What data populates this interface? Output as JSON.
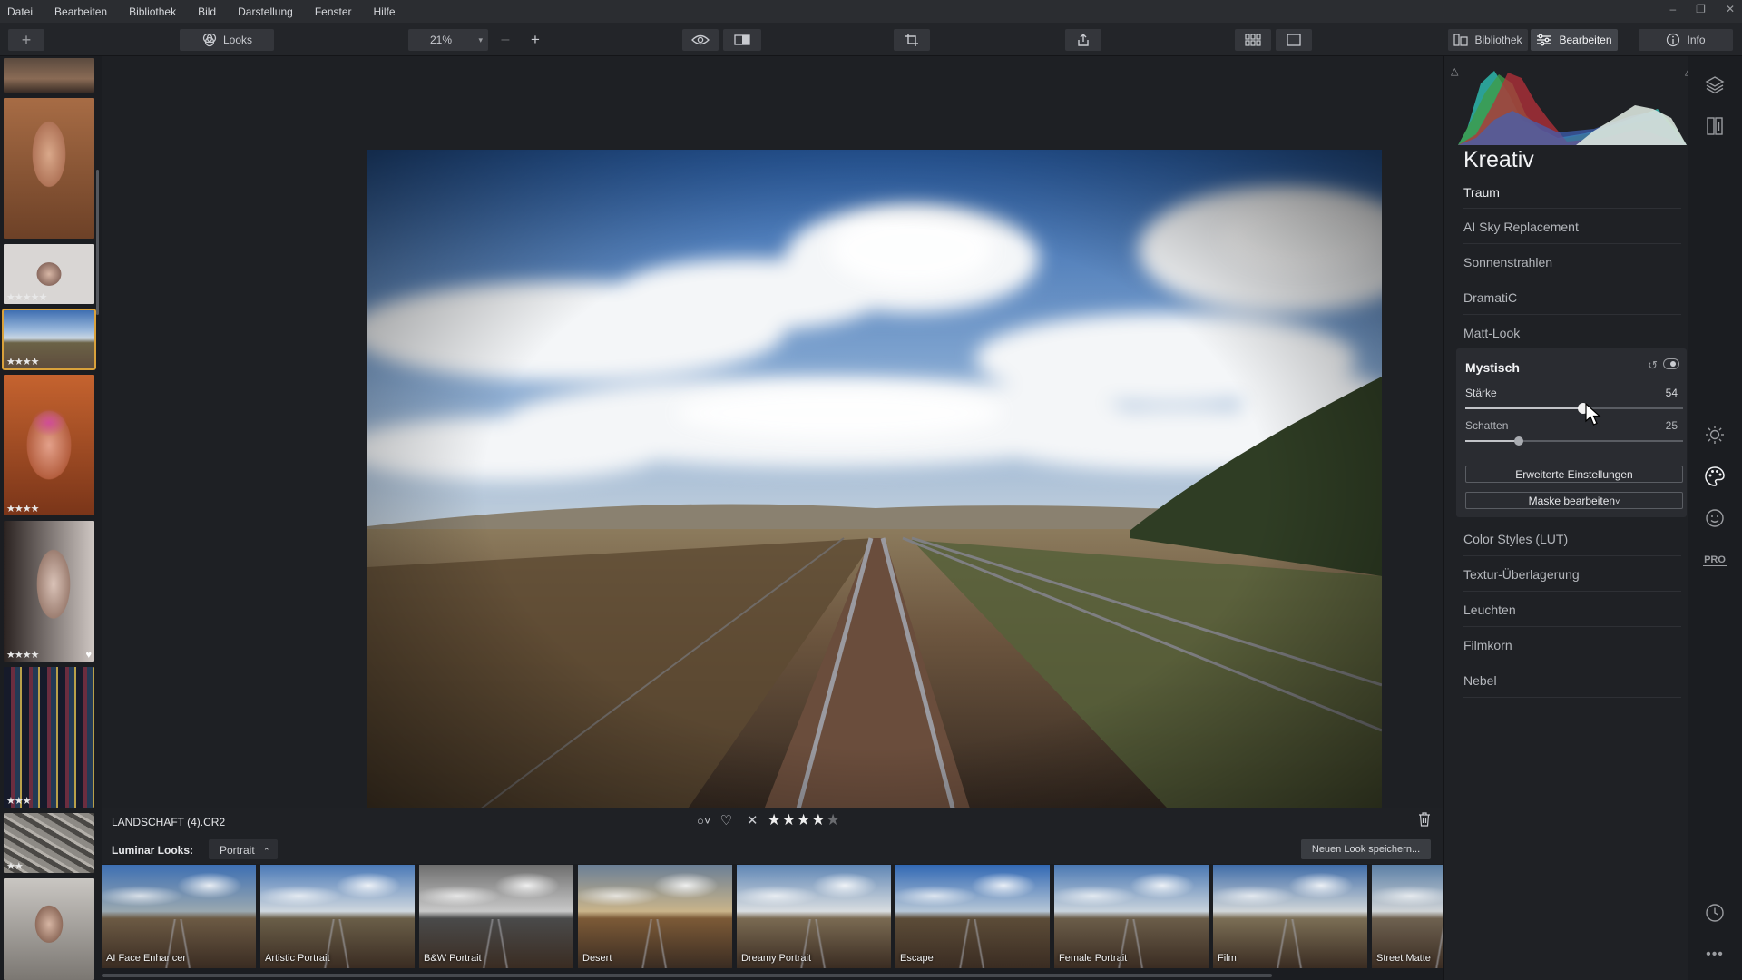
{
  "menu": [
    "Datei",
    "Bearbeiten",
    "Bibliothek",
    "Bild",
    "Darstellung",
    "Fenster",
    "Hilfe"
  ],
  "toolbar": {
    "looks_label": "Looks",
    "zoom": "21%",
    "view_tabs": [
      "Bibliothek",
      "Bearbeiten",
      "Info"
    ]
  },
  "filmstrip": [
    {
      "stars": ""
    },
    {
      "stars": ""
    },
    {
      "stars": "★★★★★"
    },
    {
      "stars": "★★★★"
    },
    {
      "stars": "★★★★"
    },
    {
      "stars": "★★★★"
    },
    {
      "stars": "★★★"
    },
    {
      "stars": "★★"
    },
    {
      "stars": ""
    }
  ],
  "info": {
    "filename": "LANDSCHAFT (4).CR2",
    "rating": 4,
    "rating_max": 5
  },
  "looks": {
    "label": "Luminar Looks:",
    "category": "Portrait",
    "save_button": "Neuen Look speichern...",
    "items": [
      "AI Face Enhancer",
      "Artistic Portrait",
      "B&W Portrait",
      "Desert",
      "Dreamy Portrait",
      "Escape",
      "Female Portrait",
      "Film",
      "Street Matte"
    ]
  },
  "panel": {
    "section_title": "Kreativ",
    "filters_top": [
      "Traum",
      "AI Sky Replacement",
      "Sonnenstrahlen",
      "DramatiC",
      "Matt-Look"
    ],
    "active_filter": {
      "name": "Mystisch",
      "sliders": [
        {
          "label": "Stärke",
          "value": 54,
          "max": 100
        },
        {
          "label": "Schatten",
          "value": 25,
          "max": 100
        }
      ],
      "advanced_button": "Erweiterte Einstellungen",
      "mask_button": "Maske bearbeiten"
    },
    "filters_bottom": [
      "Color Styles (LUT)",
      "Textur-Überlagerung",
      "Leuchten",
      "Filmkorn",
      "Nebel"
    ]
  },
  "rail": {
    "pro_label": "PRO"
  },
  "colors": {
    "accent_selected": "#d9a13b",
    "panel_bg": "#1f2125"
  }
}
